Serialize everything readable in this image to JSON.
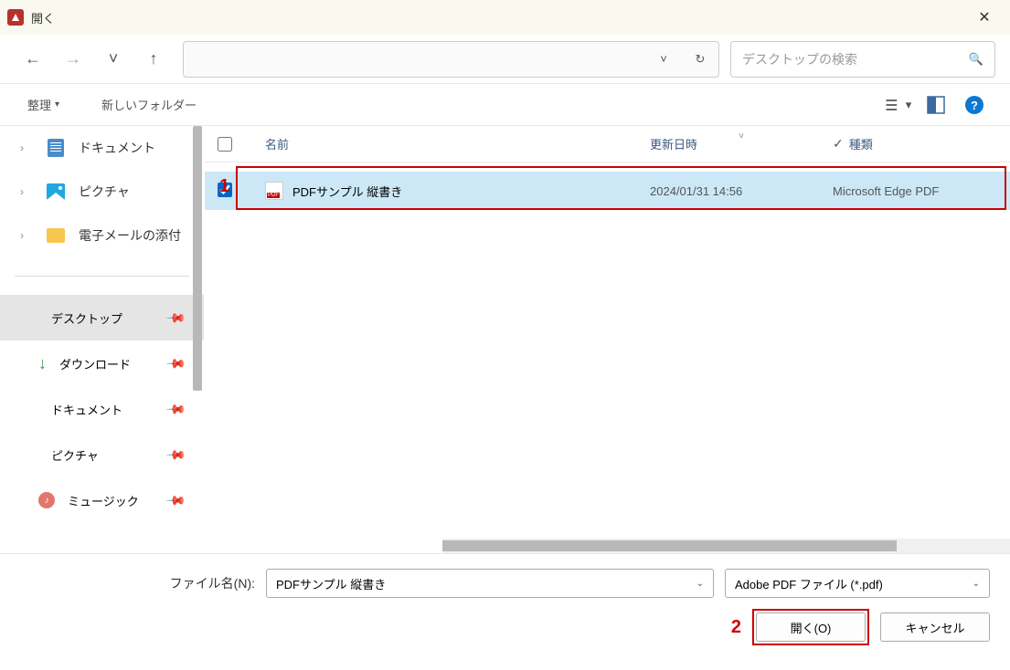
{
  "window": {
    "title": "開く"
  },
  "nav": {
    "back": "←",
    "forward": "→",
    "recent": "˅",
    "up": "↑"
  },
  "search": {
    "placeholder": "デスクトップの検索"
  },
  "toolbar": {
    "organize": "整理",
    "new_folder": "新しいフォルダー"
  },
  "sidebar": {
    "tree": [
      {
        "label": "ドキュメント",
        "icon": "doc"
      },
      {
        "label": "ピクチャ",
        "icon": "pic"
      },
      {
        "label": "電子メールの添付",
        "icon": "folder"
      }
    ],
    "quick": [
      {
        "label": "デスクトップ",
        "icon": "desk",
        "selected": true
      },
      {
        "label": "ダウンロード",
        "icon": "dl"
      },
      {
        "label": "ドキュメント",
        "icon": "doc"
      },
      {
        "label": "ピクチャ",
        "icon": "pic"
      },
      {
        "label": "ミュージック",
        "icon": "music"
      }
    ]
  },
  "list": {
    "headers": {
      "name": "名前",
      "date": "更新日時",
      "type": "種類"
    },
    "rows": [
      {
        "name": "PDFサンプル 縦書き",
        "date": "2024/01/31 14:56",
        "type": "Microsoft Edge PDF",
        "checked": true
      }
    ]
  },
  "footer": {
    "filename_label": "ファイル名(N):",
    "filename_value": "PDFサンプル 縦書き",
    "filter_value": "Adobe PDF ファイル (*.pdf)",
    "open": "開く(O)",
    "cancel": "キャンセル"
  },
  "annotations": {
    "one": "1",
    "two": "2"
  }
}
